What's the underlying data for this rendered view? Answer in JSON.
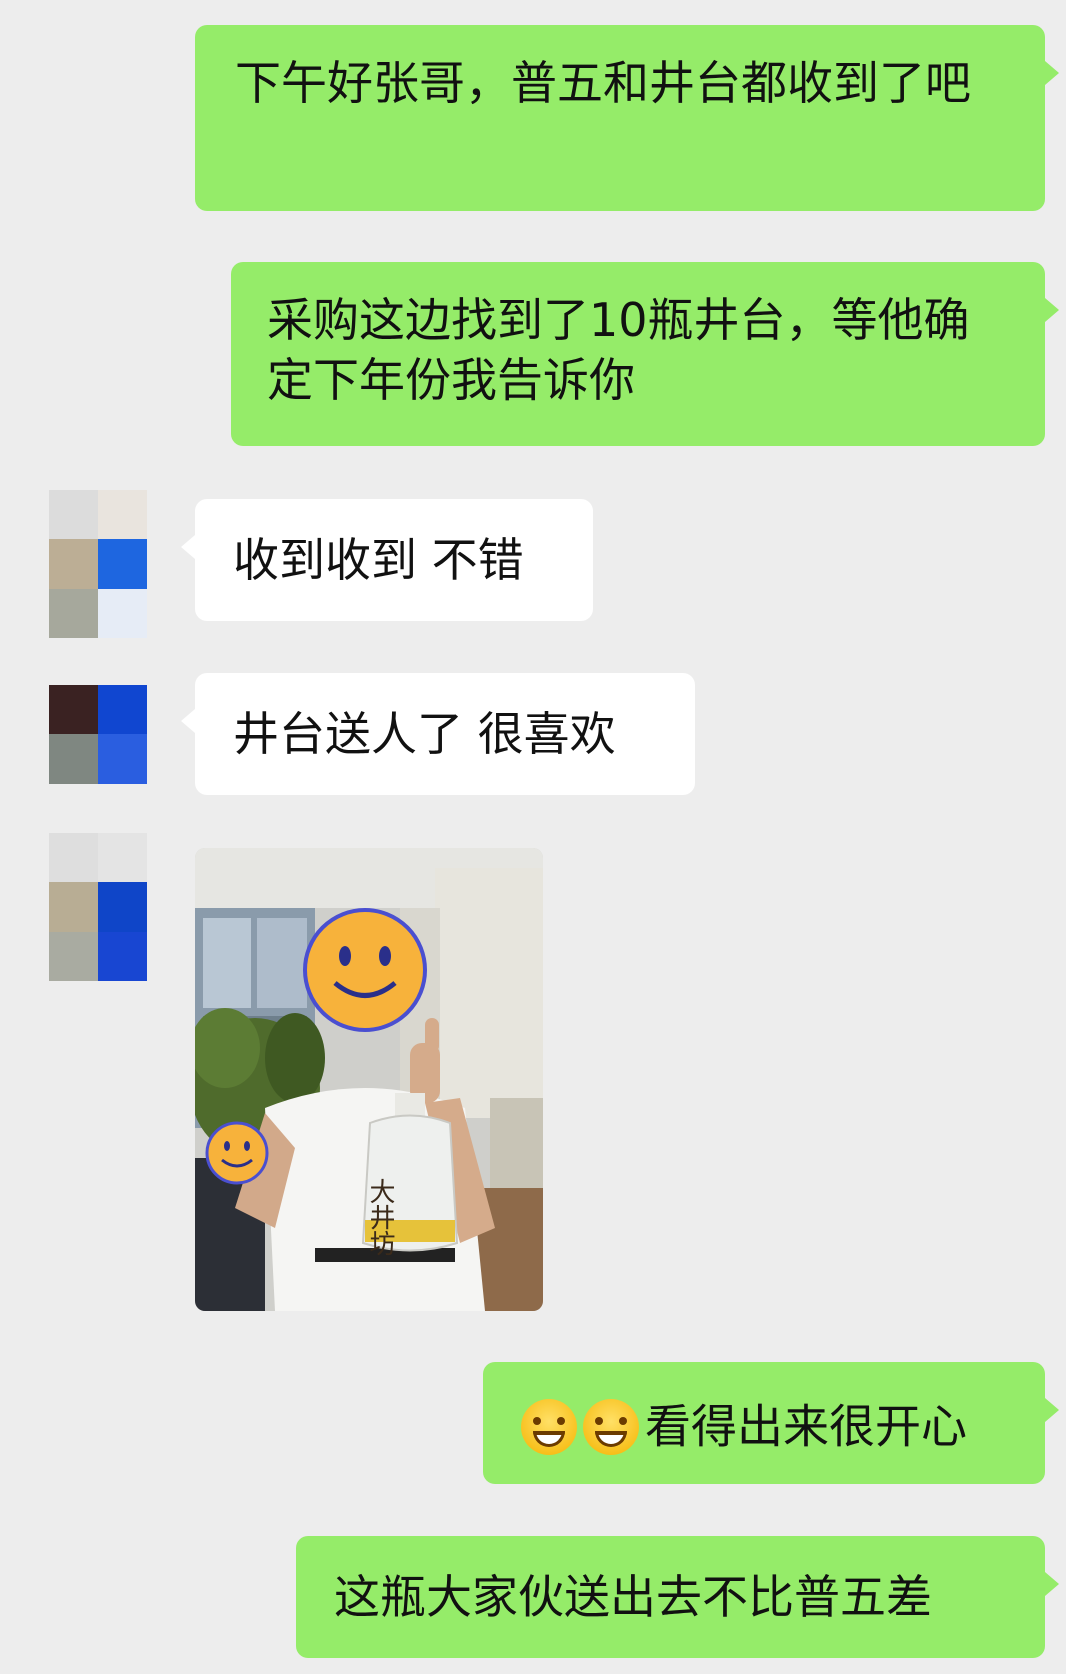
{
  "messages": [
    {
      "text": "下午好张哥，普五和井台都收到了吧"
    },
    {
      "text": "采购这边找到了10瓶井台，等他确定下年份我告诉你"
    },
    {
      "text": "收到收到 不错"
    },
    {
      "text": "井台送人了 很喜欢"
    },
    {
      "text": "看得出来很开心"
    },
    {
      "text": "这瓶大家伙送出去不比普五差"
    }
  ],
  "photo": {
    "bottle_label": "大井坊"
  },
  "colors": {
    "outgoing_bubble": "#95ec69",
    "incoming_bubble": "#ffffff",
    "background": "#ededed"
  },
  "icons": {
    "emoji": "grinning-face-icon"
  }
}
